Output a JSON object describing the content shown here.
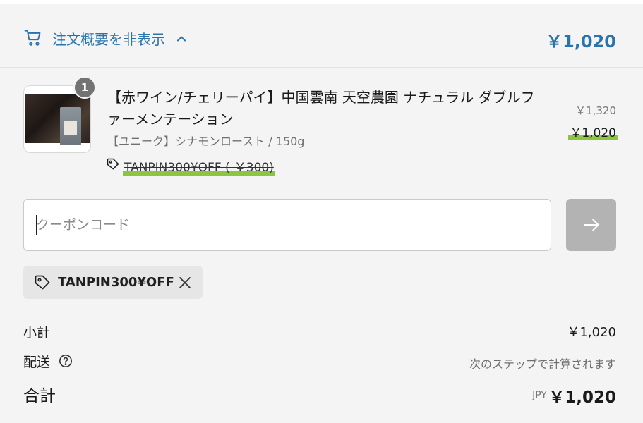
{
  "summary_toggle": {
    "label": "注文概要を非表示",
    "total": "￥1,020",
    "accent_color": "#2a74ad"
  },
  "product": {
    "title": "【赤ワイン/チェリーパイ】中国雲南 天空農園 ナチュラル ダブルファーメンテーション",
    "variant": "【ユニーク】シナモンロースト / 150g",
    "quantity": "1",
    "discount": "TANPIN300¥OFF (-￥300)",
    "price_original": "￥1,320",
    "price_current": "￥1,020",
    "highlight_color": "#8cc63f"
  },
  "coupon": {
    "placeholder": "クーポンコード",
    "value": "",
    "applied_code": "TANPIN300¥OFF"
  },
  "totals": {
    "subtotal_label": "小計",
    "subtotal_value": "￥1,020",
    "shipping_label": "配送",
    "shipping_value": "次のステップで計算されます",
    "total_label": "合計",
    "currency": "JPY",
    "total_value": "￥1,020"
  },
  "icons": [
    "cart-icon",
    "chevron-up-icon",
    "tag-icon",
    "arrow-right-icon",
    "close-icon",
    "help-icon"
  ]
}
